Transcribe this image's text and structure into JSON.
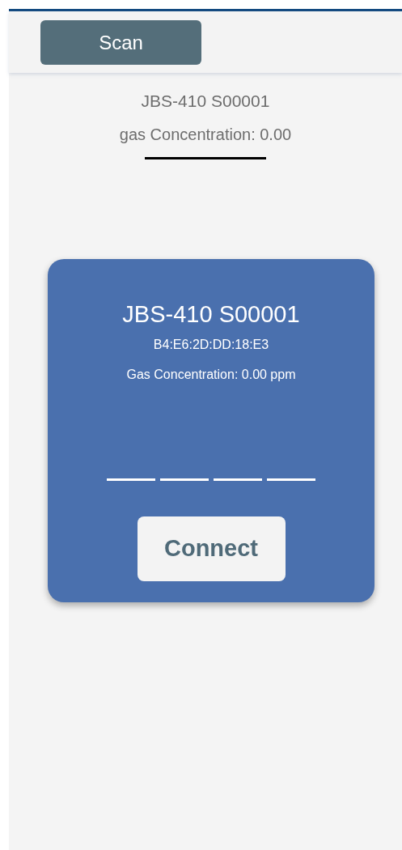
{
  "header": {
    "scan_button": "Scan"
  },
  "device_summary": {
    "name": "JBS-410 S00001",
    "concentration": "gas Concentration: 0.00"
  },
  "device_card": {
    "name": "JBS-410 S00001",
    "address": "B4:E6:2D:DD:18:E3",
    "concentration": "Gas Concentration: 0.00 ppm",
    "pin_fields": [
      {
        "kind": "digit"
      },
      {
        "kind": "digit"
      },
      {
        "kind": "digit"
      },
      {
        "kind": "digit"
      }
    ],
    "connect_button": "Connect"
  }
}
